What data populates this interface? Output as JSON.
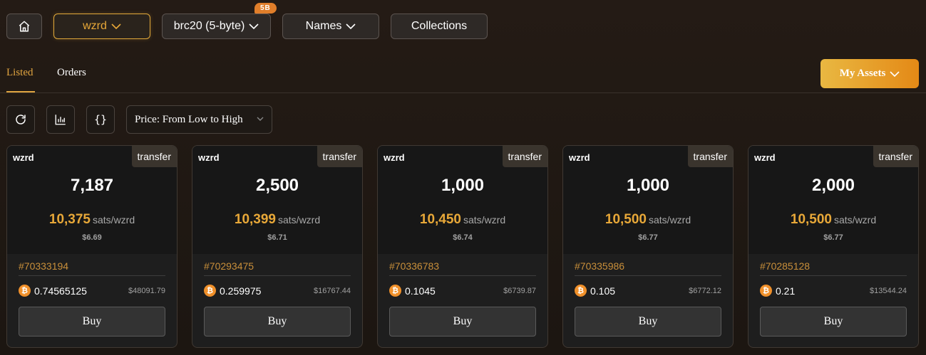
{
  "nav": {
    "home_icon": "home-icon",
    "wzrd_label": "wzrd",
    "brc20_label": "brc20 (5-byte)",
    "brc20_badge": "5B",
    "names_label": "Names",
    "collections_label": "Collections",
    "accent": "#e8a838"
  },
  "tabs": {
    "listed": "Listed",
    "orders": "Orders"
  },
  "my_assets": "My Assets",
  "toolbar": {
    "refresh_icon": "refresh-icon",
    "chart_icon": "chart-icon",
    "code_icon": "code-braces-icon",
    "code_glyph": "{}",
    "sort_value": "Price: From Low to High"
  },
  "cards": [
    {
      "ticker": "wzrd",
      "type": "transfer",
      "amount": "7,187",
      "price": "10,375",
      "unit": "sats/wzrd",
      "usd": "$6.69",
      "inscription": "#70333194",
      "btc": "0.74565125",
      "btc_usd": "$48091.79",
      "buy": "Buy"
    },
    {
      "ticker": "wzrd",
      "type": "transfer",
      "amount": "2,500",
      "price": "10,399",
      "unit": "sats/wzrd",
      "usd": "$6.71",
      "inscription": "#70293475",
      "btc": "0.259975",
      "btc_usd": "$16767.44",
      "buy": "Buy"
    },
    {
      "ticker": "wzrd",
      "type": "transfer",
      "amount": "1,000",
      "price": "10,450",
      "unit": "sats/wzrd",
      "usd": "$6.74",
      "inscription": "#70336783",
      "btc": "0.1045",
      "btc_usd": "$6739.87",
      "buy": "Buy"
    },
    {
      "ticker": "wzrd",
      "type": "transfer",
      "amount": "1,000",
      "price": "10,500",
      "unit": "sats/wzrd",
      "usd": "$6.77",
      "inscription": "#70335986",
      "btc": "0.105",
      "btc_usd": "$6772.12",
      "buy": "Buy"
    },
    {
      "ticker": "wzrd",
      "type": "transfer",
      "amount": "2,000",
      "price": "10,500",
      "unit": "sats/wzrd",
      "usd": "$6.77",
      "inscription": "#70285128",
      "btc": "0.21",
      "btc_usd": "$13544.24",
      "buy": "Buy"
    }
  ]
}
